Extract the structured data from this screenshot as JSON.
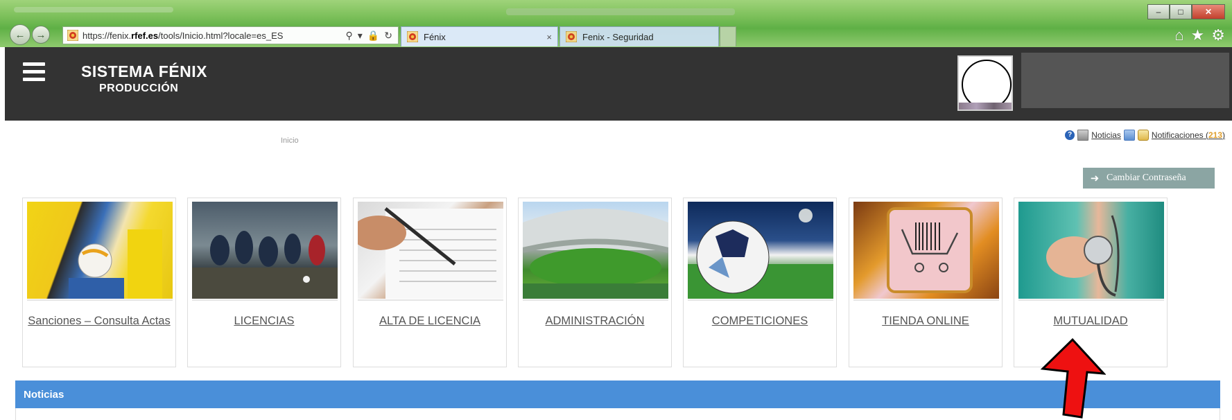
{
  "browser": {
    "url_prefix": "https://fenix.",
    "url_domain": "rfef.es",
    "url_suffix": "/tools/Inicio.html?locale=es_ES",
    "tabs": [
      {
        "label": "Fénix",
        "close": "×"
      },
      {
        "label": "Fenix - Seguridad"
      }
    ]
  },
  "header": {
    "title": "SISTEMA FÉNIX",
    "subtitle": "PRODUCCIÓN"
  },
  "breadcrumb": "Inicio",
  "top_links": {
    "help": "?",
    "news": "Noticias",
    "notifications": "Notificaciones",
    "notifications_count": "213"
  },
  "change_password": {
    "arrow": "➜",
    "label": "Cambiar Contraseña"
  },
  "tiles": [
    {
      "label": "Sanciones – Consulta Actas"
    },
    {
      "label": "LICENCIAS"
    },
    {
      "label": "ALTA DE LICENCIA"
    },
    {
      "label": "ADMINISTRACIÓN"
    },
    {
      "label": "COMPETICIONES"
    },
    {
      "label": "TIENDA ONLINE"
    },
    {
      "label": "MUTUALIDAD"
    }
  ],
  "news_section": {
    "title": "Noticias"
  },
  "colors": {
    "header_bg": "#333333",
    "news_bar": "#4a8fd9",
    "annotation_arrow": "#ee1111"
  }
}
